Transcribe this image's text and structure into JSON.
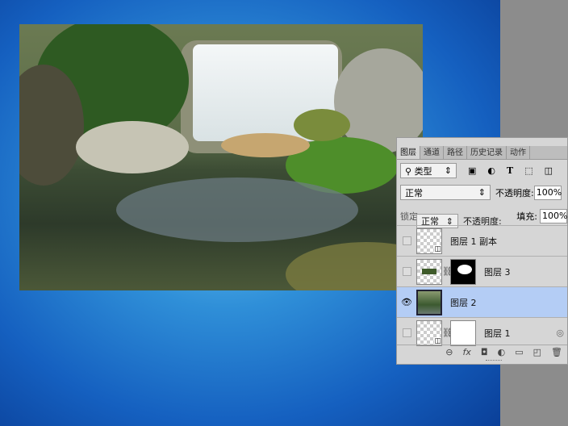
{
  "panel": {
    "tabs": [
      "图层",
      "通道",
      "路径",
      "历史记录",
      "动作"
    ],
    "filter_label": "类型",
    "blend_mode": "正常",
    "opacity_label": "不透明度:",
    "opacity_value": "100%",
    "lock_label": "锁定:",
    "fill_label": "填充:",
    "fill_value": "100%",
    "drag_ghost": {
      "blend_mode": "正常",
      "opacity_label": "不透明度:"
    },
    "layers": [
      {
        "name": "图层 1 副本",
        "visible": false,
        "selected": false
      },
      {
        "name": "图层 3",
        "visible": false,
        "selected": false
      },
      {
        "name": "图层 2",
        "visible": true,
        "selected": true
      },
      {
        "name": "图层 1",
        "visible": false,
        "selected": false
      }
    ],
    "footer_icons": [
      "link-icon",
      "fx-icon",
      "mask-icon",
      "adjustment-icon",
      "folder-icon",
      "new-layer-icon",
      "trash-icon"
    ],
    "fx_label": "fx"
  },
  "colors": {
    "selected_row": "#b4cdf5",
    "panel_bg": "#d6d6d6"
  }
}
